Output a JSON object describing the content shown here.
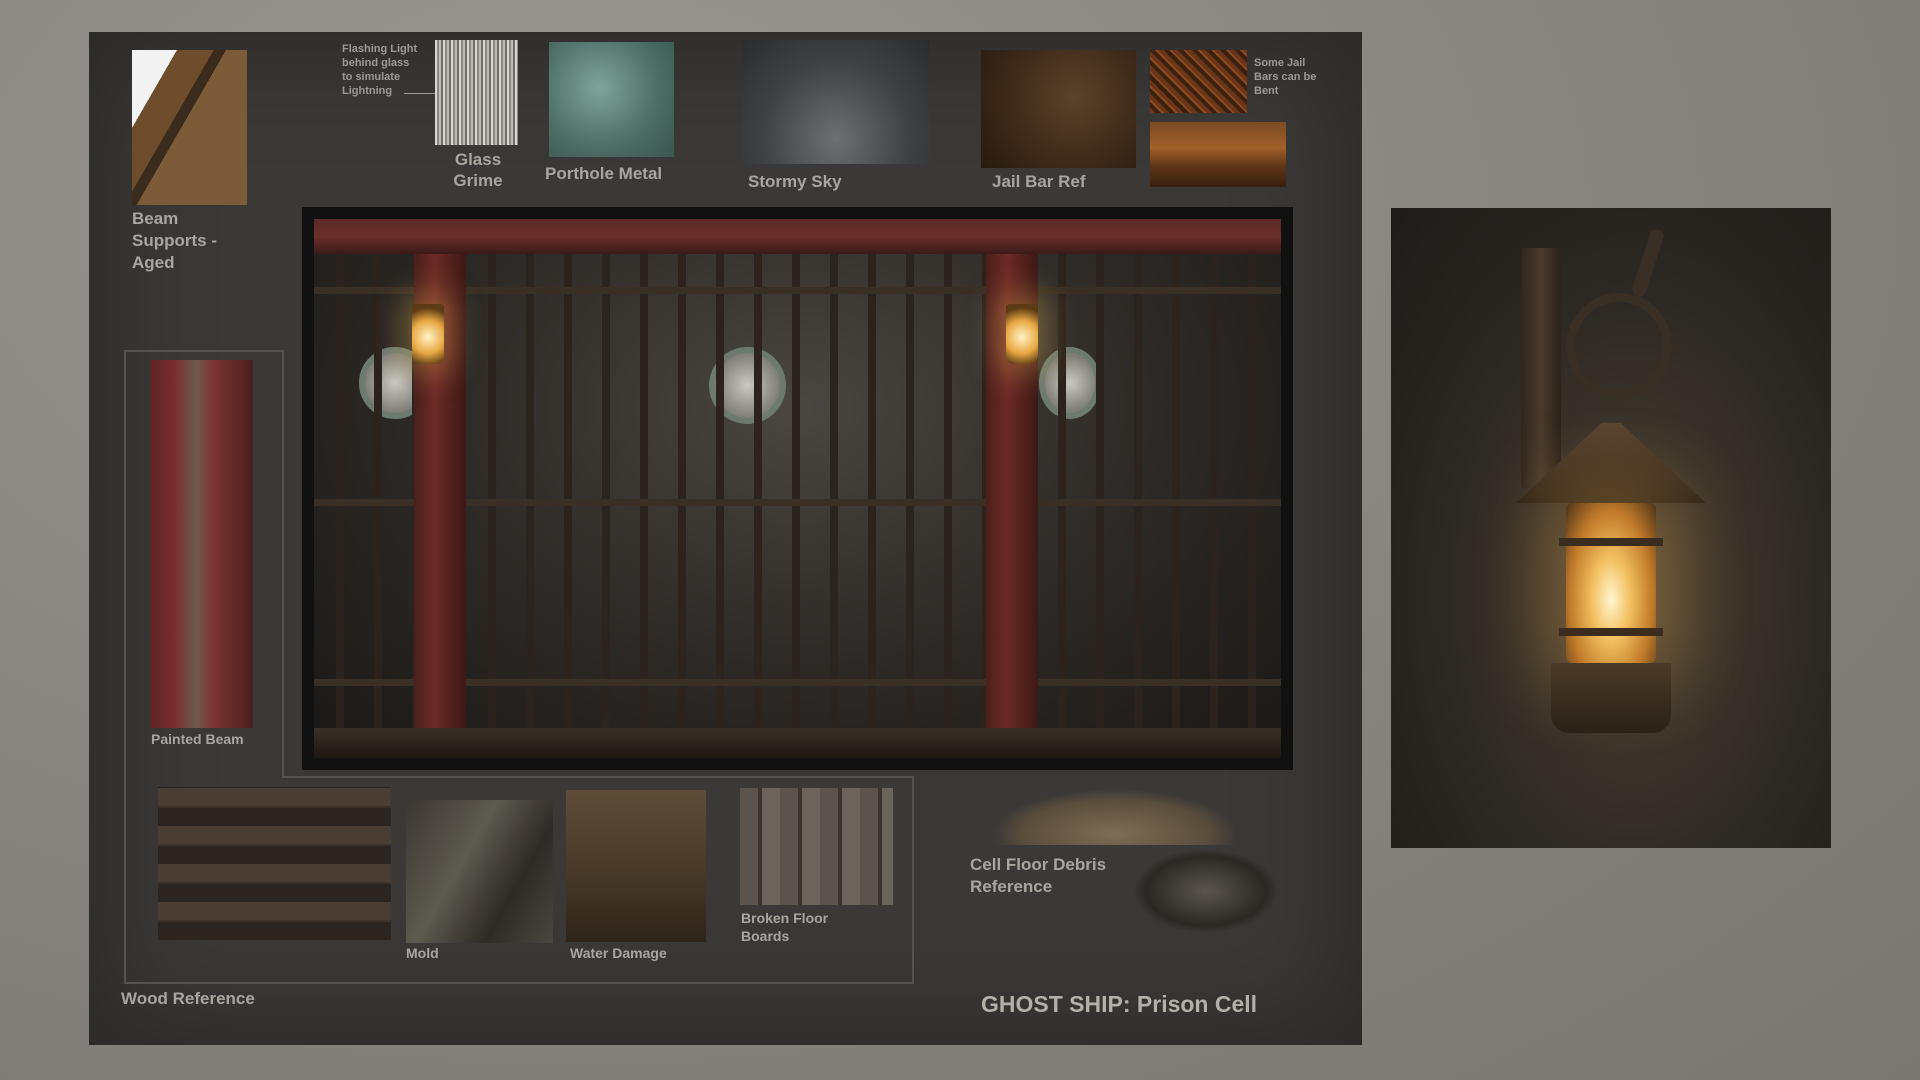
{
  "labels": {
    "beam_supports": "Beam Supports - Aged",
    "glass_note": "Flashing Light behind glass to simulate Lightning",
    "glass_grime": "Glass Grime",
    "porthole_metal": "Porthole Metal",
    "stormy_sky": "Stormy Sky",
    "jail_bar_ref": "Jail Bar Ref",
    "jail_note": "Some Jail Bars can be Bent",
    "painted_beam": "Painted Beam",
    "mold": "Mold",
    "water_damage": "Water Damage",
    "broken_floor": "Broken Floor Boards",
    "debris_ref": "Cell Floor Debris Reference",
    "wood_reference": "Wood Reference",
    "title": "GHOST SHIP: Prison Cell"
  }
}
